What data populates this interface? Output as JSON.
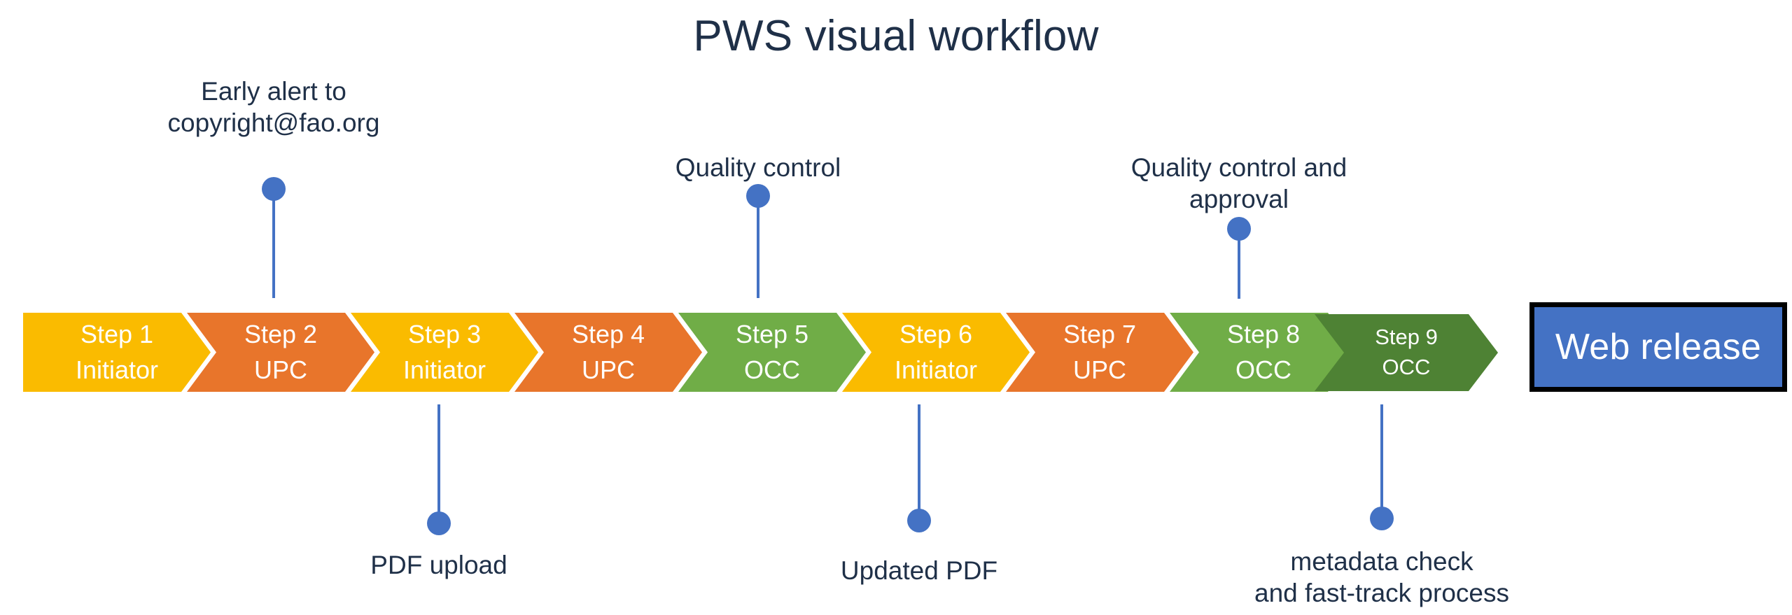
{
  "page": {
    "title": "PWS visual workflow",
    "background": "#ffffff",
    "title_color": "#1F3048"
  },
  "palette": {
    "amber": "#FABB00",
    "orange": "#E8752B",
    "green": "#70AD47",
    "dark_green": "#4E8234",
    "marker_blue": "#4472C4",
    "box_border": "#000000",
    "label_white": "#FFFFFF"
  },
  "workflow": {
    "steps": [
      {
        "id": "step-1",
        "name": "Step 1",
        "actor": "Initiator",
        "color": "#FABB00"
      },
      {
        "id": "step-2",
        "name": "Step 2",
        "actor": "UPC",
        "color": "#E8752B"
      },
      {
        "id": "step-3",
        "name": "Step 3",
        "actor": "Initiator",
        "color": "#FABB00"
      },
      {
        "id": "step-4",
        "name": "Step 4",
        "actor": "UPC",
        "color": "#E8752B"
      },
      {
        "id": "step-5",
        "name": "Step 5",
        "actor": "OCC",
        "color": "#70AD47"
      },
      {
        "id": "step-6",
        "name": "Step 6",
        "actor": "Initiator",
        "color": "#FABB00"
      },
      {
        "id": "step-7",
        "name": "Step 7",
        "actor": "UPC",
        "color": "#E8752B"
      },
      {
        "id": "step-8",
        "name": "Step 8",
        "actor": "OCC",
        "color": "#70AD47"
      },
      {
        "id": "step-9",
        "name": "Step 9",
        "actor": "OCC",
        "color": "#4E8234"
      }
    ],
    "outcome": {
      "label": "Web release",
      "fill": "#4472C4",
      "border": "#000000"
    },
    "annotations": [
      {
        "id": "ann-step-2",
        "text": "Early alert to\ncopyright@fao.org",
        "attached_to": "Step 2",
        "position": "above"
      },
      {
        "id": "ann-step-5",
        "text": "Quality control",
        "attached_to": "Step 5",
        "position": "above"
      },
      {
        "id": "ann-step-8",
        "text": "Quality control and\napproval",
        "attached_to": "Step 8",
        "position": "above"
      },
      {
        "id": "ann-step-3",
        "text": "PDF upload",
        "attached_to": "Step 3",
        "position": "below"
      },
      {
        "id": "ann-step-6",
        "text": "Updated PDF",
        "attached_to": "Step 6",
        "position": "below"
      },
      {
        "id": "ann-step-9",
        "text": "metadata check\nand fast-track process",
        "attached_to": "Step 9",
        "position": "below"
      }
    ]
  }
}
